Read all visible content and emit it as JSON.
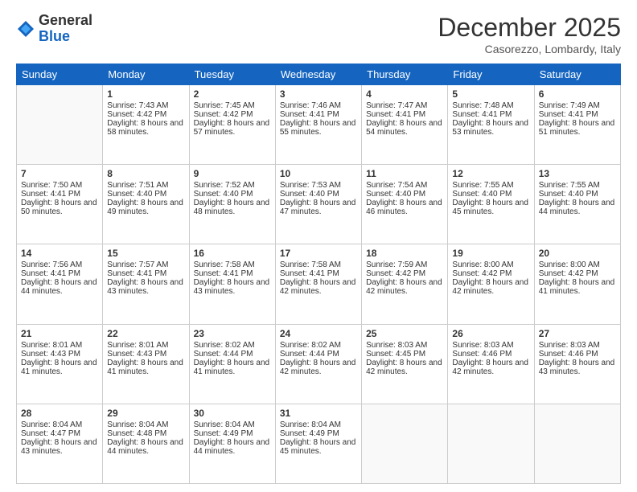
{
  "logo": {
    "general": "General",
    "blue": "Blue"
  },
  "header": {
    "month": "December 2025",
    "location": "Casorezzo, Lombardy, Italy"
  },
  "days": [
    "Sunday",
    "Monday",
    "Tuesday",
    "Wednesday",
    "Thursday",
    "Friday",
    "Saturday"
  ],
  "weeks": [
    [
      {
        "day": "",
        "sunrise": "",
        "sunset": "",
        "daylight": ""
      },
      {
        "day": "1",
        "sunrise": "Sunrise: 7:43 AM",
        "sunset": "Sunset: 4:42 PM",
        "daylight": "Daylight: 8 hours and 58 minutes."
      },
      {
        "day": "2",
        "sunrise": "Sunrise: 7:45 AM",
        "sunset": "Sunset: 4:42 PM",
        "daylight": "Daylight: 8 hours and 57 minutes."
      },
      {
        "day": "3",
        "sunrise": "Sunrise: 7:46 AM",
        "sunset": "Sunset: 4:41 PM",
        "daylight": "Daylight: 8 hours and 55 minutes."
      },
      {
        "day": "4",
        "sunrise": "Sunrise: 7:47 AM",
        "sunset": "Sunset: 4:41 PM",
        "daylight": "Daylight: 8 hours and 54 minutes."
      },
      {
        "day": "5",
        "sunrise": "Sunrise: 7:48 AM",
        "sunset": "Sunset: 4:41 PM",
        "daylight": "Daylight: 8 hours and 53 minutes."
      },
      {
        "day": "6",
        "sunrise": "Sunrise: 7:49 AM",
        "sunset": "Sunset: 4:41 PM",
        "daylight": "Daylight: 8 hours and 51 minutes."
      }
    ],
    [
      {
        "day": "7",
        "sunrise": "Sunrise: 7:50 AM",
        "sunset": "Sunset: 4:41 PM",
        "daylight": "Daylight: 8 hours and 50 minutes."
      },
      {
        "day": "8",
        "sunrise": "Sunrise: 7:51 AM",
        "sunset": "Sunset: 4:40 PM",
        "daylight": "Daylight: 8 hours and 49 minutes."
      },
      {
        "day": "9",
        "sunrise": "Sunrise: 7:52 AM",
        "sunset": "Sunset: 4:40 PM",
        "daylight": "Daylight: 8 hours and 48 minutes."
      },
      {
        "day": "10",
        "sunrise": "Sunrise: 7:53 AM",
        "sunset": "Sunset: 4:40 PM",
        "daylight": "Daylight: 8 hours and 47 minutes."
      },
      {
        "day": "11",
        "sunrise": "Sunrise: 7:54 AM",
        "sunset": "Sunset: 4:40 PM",
        "daylight": "Daylight: 8 hours and 46 minutes."
      },
      {
        "day": "12",
        "sunrise": "Sunrise: 7:55 AM",
        "sunset": "Sunset: 4:40 PM",
        "daylight": "Daylight: 8 hours and 45 minutes."
      },
      {
        "day": "13",
        "sunrise": "Sunrise: 7:55 AM",
        "sunset": "Sunset: 4:40 PM",
        "daylight": "Daylight: 8 hours and 44 minutes."
      }
    ],
    [
      {
        "day": "14",
        "sunrise": "Sunrise: 7:56 AM",
        "sunset": "Sunset: 4:41 PM",
        "daylight": "Daylight: 8 hours and 44 minutes."
      },
      {
        "day": "15",
        "sunrise": "Sunrise: 7:57 AM",
        "sunset": "Sunset: 4:41 PM",
        "daylight": "Daylight: 8 hours and 43 minutes."
      },
      {
        "day": "16",
        "sunrise": "Sunrise: 7:58 AM",
        "sunset": "Sunset: 4:41 PM",
        "daylight": "Daylight: 8 hours and 43 minutes."
      },
      {
        "day": "17",
        "sunrise": "Sunrise: 7:58 AM",
        "sunset": "Sunset: 4:41 PM",
        "daylight": "Daylight: 8 hours and 42 minutes."
      },
      {
        "day": "18",
        "sunrise": "Sunrise: 7:59 AM",
        "sunset": "Sunset: 4:42 PM",
        "daylight": "Daylight: 8 hours and 42 minutes."
      },
      {
        "day": "19",
        "sunrise": "Sunrise: 8:00 AM",
        "sunset": "Sunset: 4:42 PM",
        "daylight": "Daylight: 8 hours and 42 minutes."
      },
      {
        "day": "20",
        "sunrise": "Sunrise: 8:00 AM",
        "sunset": "Sunset: 4:42 PM",
        "daylight": "Daylight: 8 hours and 41 minutes."
      }
    ],
    [
      {
        "day": "21",
        "sunrise": "Sunrise: 8:01 AM",
        "sunset": "Sunset: 4:43 PM",
        "daylight": "Daylight: 8 hours and 41 minutes."
      },
      {
        "day": "22",
        "sunrise": "Sunrise: 8:01 AM",
        "sunset": "Sunset: 4:43 PM",
        "daylight": "Daylight: 8 hours and 41 minutes."
      },
      {
        "day": "23",
        "sunrise": "Sunrise: 8:02 AM",
        "sunset": "Sunset: 4:44 PM",
        "daylight": "Daylight: 8 hours and 41 minutes."
      },
      {
        "day": "24",
        "sunrise": "Sunrise: 8:02 AM",
        "sunset": "Sunset: 4:44 PM",
        "daylight": "Daylight: 8 hours and 42 minutes."
      },
      {
        "day": "25",
        "sunrise": "Sunrise: 8:03 AM",
        "sunset": "Sunset: 4:45 PM",
        "daylight": "Daylight: 8 hours and 42 minutes."
      },
      {
        "day": "26",
        "sunrise": "Sunrise: 8:03 AM",
        "sunset": "Sunset: 4:46 PM",
        "daylight": "Daylight: 8 hours and 42 minutes."
      },
      {
        "day": "27",
        "sunrise": "Sunrise: 8:03 AM",
        "sunset": "Sunset: 4:46 PM",
        "daylight": "Daylight: 8 hours and 43 minutes."
      }
    ],
    [
      {
        "day": "28",
        "sunrise": "Sunrise: 8:04 AM",
        "sunset": "Sunset: 4:47 PM",
        "daylight": "Daylight: 8 hours and 43 minutes."
      },
      {
        "day": "29",
        "sunrise": "Sunrise: 8:04 AM",
        "sunset": "Sunset: 4:48 PM",
        "daylight": "Daylight: 8 hours and 44 minutes."
      },
      {
        "day": "30",
        "sunrise": "Sunrise: 8:04 AM",
        "sunset": "Sunset: 4:49 PM",
        "daylight": "Daylight: 8 hours and 44 minutes."
      },
      {
        "day": "31",
        "sunrise": "Sunrise: 8:04 AM",
        "sunset": "Sunset: 4:49 PM",
        "daylight": "Daylight: 8 hours and 45 minutes."
      },
      {
        "day": "",
        "sunrise": "",
        "sunset": "",
        "daylight": ""
      },
      {
        "day": "",
        "sunrise": "",
        "sunset": "",
        "daylight": ""
      },
      {
        "day": "",
        "sunrise": "",
        "sunset": "",
        "daylight": ""
      }
    ]
  ]
}
